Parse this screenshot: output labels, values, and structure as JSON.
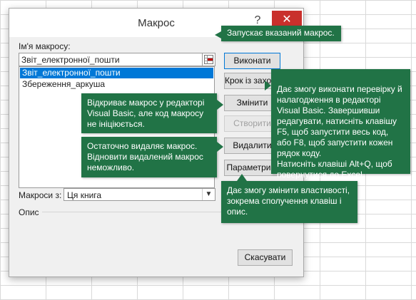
{
  "dialog": {
    "title": "Макрос",
    "help_label": "?",
    "close_label": "✕",
    "macro_name_label": "Ім'я макросу:",
    "macro_name_value": "Звіт_електронної_пошти",
    "macro_list": [
      {
        "name": "Звіт_електронної_пошти",
        "selected": true
      },
      {
        "name": "Збереження_аркуша",
        "selected": false
      }
    ],
    "buttons": {
      "run": "Виконати",
      "step_into": "Крок із заходом",
      "edit": "Змінити",
      "create": "Створити",
      "delete": "Видалити",
      "options": "Параметри..."
    },
    "macros_in_label": "Макроси з:",
    "macros_in_value": "Ця книга",
    "description_label": "Опис",
    "cancel": "Скасувати"
  },
  "callouts": {
    "run": "Запускає вказаний макрос.",
    "step_into": "Дає змогу виконати перевірку й налагодження в редакторі Visual Basic. Завершивши редагувати, натисніть клавішу F5, щоб запустити весь код, або F8, щоб запустити кожен рядок коду.\nНатисніть клавіші Alt+Q, щоб повернутися до Excel.",
    "edit": "Відкриває макрос у редакторі Visual Basic, але код макросу не ініціюється.",
    "delete": "Остаточно видаляє макрос. Відновити видалений макрос неможливо.",
    "options": "Дає змогу змінити властивості, зокрема сполучення клавіш і опис."
  },
  "colors": {
    "callout_bg": "#217346",
    "selection": "#0078d7",
    "close_button": "#c9302c"
  }
}
